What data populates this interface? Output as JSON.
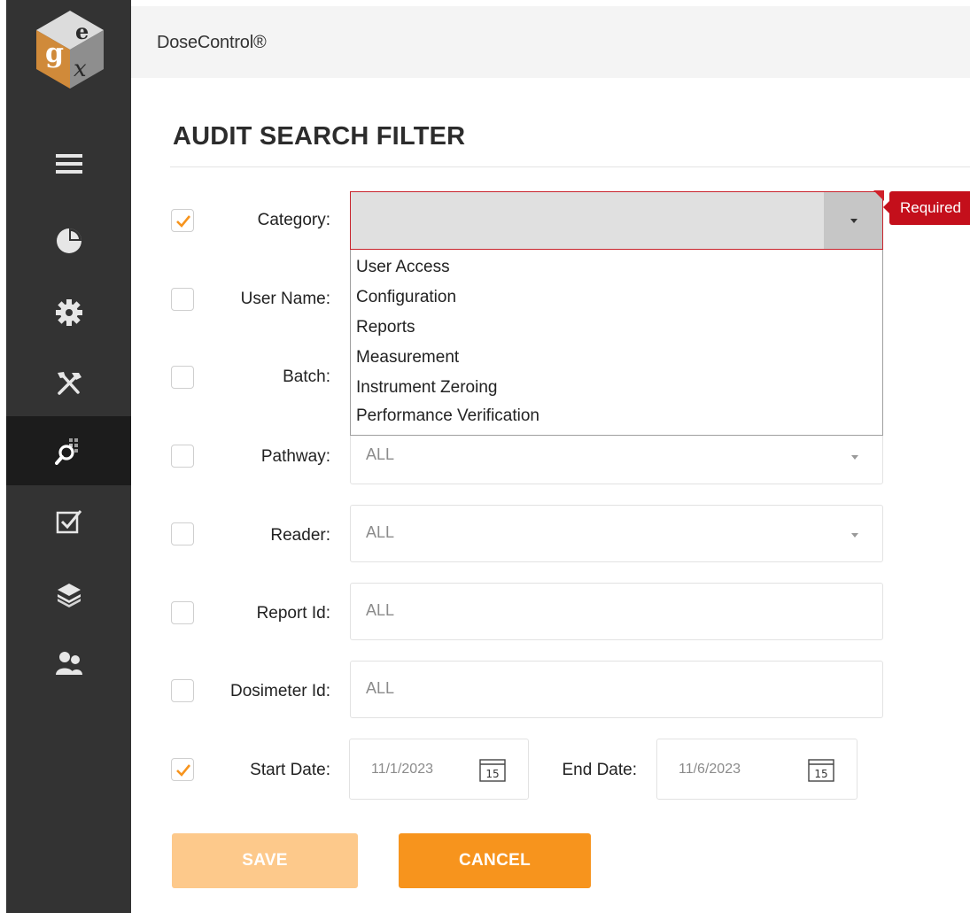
{
  "app": {
    "title": "DoseControl®"
  },
  "sidebar": {
    "logo_icon": "gex-cube-logo",
    "items": [
      {
        "icon": "hamburger-menu-icon",
        "active": false
      },
      {
        "icon": "pie-chart-icon",
        "active": false
      },
      {
        "icon": "gear-icon",
        "active": false
      },
      {
        "icon": "tools-icon",
        "active": false
      },
      {
        "icon": "audit-search-icon",
        "active": true
      },
      {
        "icon": "checkbox-icon",
        "active": false
      },
      {
        "icon": "layers-icon",
        "active": false
      },
      {
        "icon": "users-icon",
        "active": false
      }
    ]
  },
  "page": {
    "title": "AUDIT SEARCH FILTER"
  },
  "filters": {
    "category": {
      "label": "Category:",
      "checked": true,
      "value": "",
      "error": "Required"
    },
    "category_options": [
      "User Access",
      "Configuration",
      "Reports",
      "Measurement",
      "Instrument Zeroing",
      "Performance Verification"
    ],
    "user_name": {
      "label": "User Name:",
      "checked": false
    },
    "batch": {
      "label": "Batch:",
      "checked": false
    },
    "pathway": {
      "label": "Pathway:",
      "checked": false,
      "value": "ALL"
    },
    "reader": {
      "label": "Reader:",
      "checked": false,
      "value": "ALL"
    },
    "report_id": {
      "label": "Report Id:",
      "checked": false,
      "value": "ALL"
    },
    "dosimeter_id": {
      "label": "Dosimeter Id:",
      "checked": false,
      "value": "ALL"
    },
    "start_date": {
      "label": "Start Date:",
      "checked": true,
      "value": "11/1/2023",
      "calendar_day": "15"
    },
    "end_date": {
      "label": "End Date:",
      "value": "11/6/2023",
      "calendar_day": "15"
    }
  },
  "buttons": {
    "save": "SAVE",
    "cancel": "CANCEL"
  },
  "colors": {
    "sidebar": "#333333",
    "accent": "#f7941d",
    "accent_disabled": "#fdc98b",
    "error": "#c40f1b"
  }
}
